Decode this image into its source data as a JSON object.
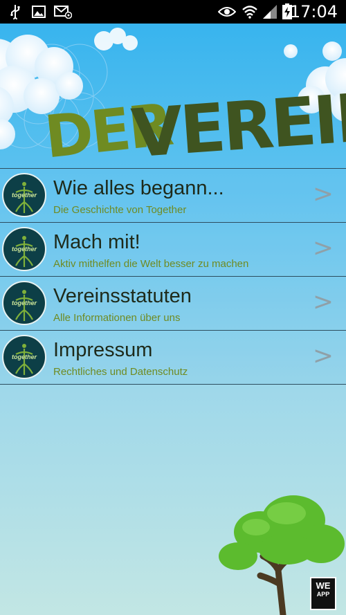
{
  "status_bar": {
    "time": "17:04",
    "icons": [
      "usb-icon",
      "image-icon",
      "mail-icon",
      "eye-icon",
      "wifi-icon",
      "signal-icon",
      "battery-charging-icon"
    ]
  },
  "header": {
    "title_part1": "DER",
    "title_part2": "VEREIN"
  },
  "menu": {
    "items": [
      {
        "title": "Wie alles begann...",
        "subtitle": "Die Geschichte von Together",
        "chevron": ">"
      },
      {
        "title": "Mach mit!",
        "subtitle": "Aktiv mithelfen die Welt besser zu machen",
        "chevron": ">"
      },
      {
        "title": "Vereinsstatuten",
        "subtitle": "Alle Informationen über uns",
        "chevron": ">"
      },
      {
        "title": "Impressum",
        "subtitle": "Rechtliches und Datenschutz",
        "chevron": ">"
      }
    ],
    "logo_text": "together"
  },
  "badge": {
    "line1": "WE",
    "line2": "APP"
  },
  "colors": {
    "sky_top": "#38b4ee",
    "sky_bottom": "#c2e6e4",
    "title_green": "#6f8b22",
    "title_dark": "#3a4a1a",
    "row_title": "#1e2a1a",
    "tree_green": "#5cbb2e"
  }
}
